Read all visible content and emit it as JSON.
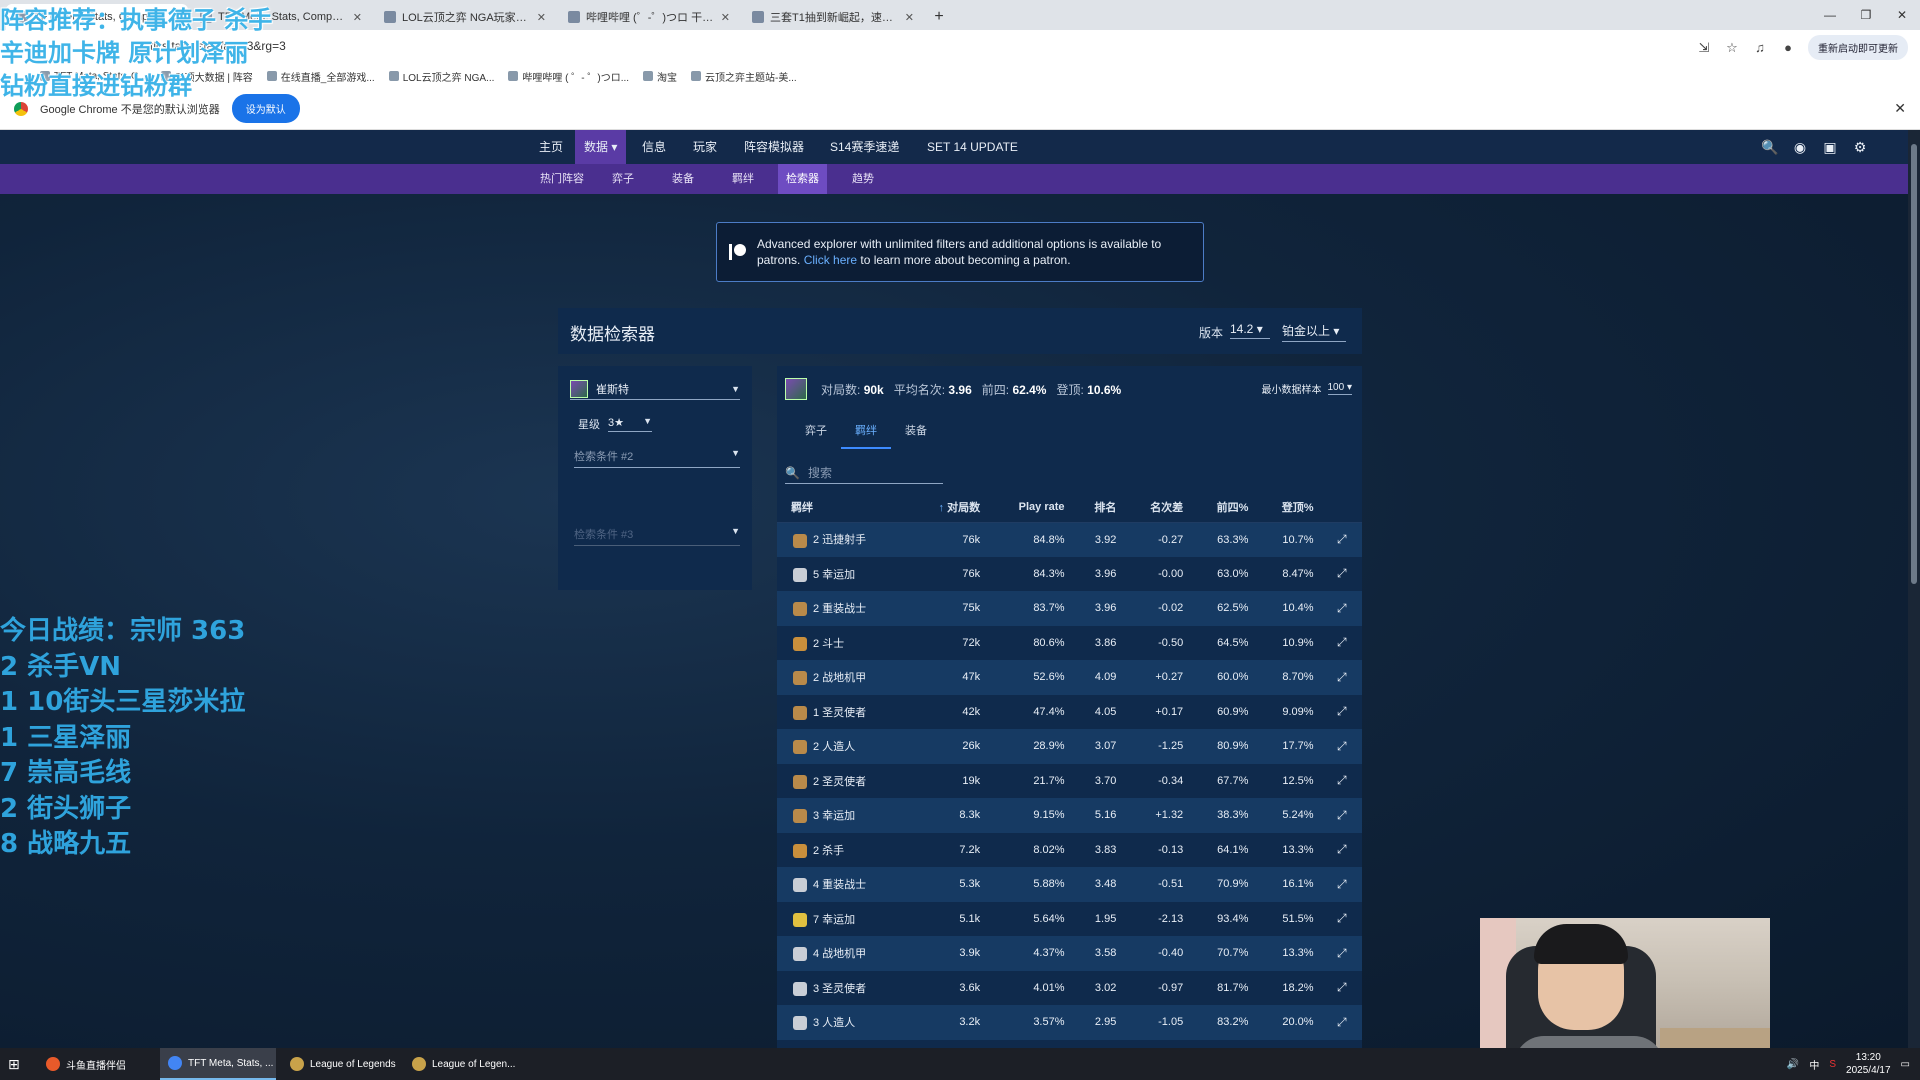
{
  "browser": {
    "tabs": [
      {
        "label": "TFT Meta, Stats, Comps, Mat",
        "active": true
      },
      {
        "label": "TFT Meta, Stats, Comps, Mat",
        "active": false
      },
      {
        "label": "LOL云顶之弈 NGA玩家社区 P1",
        "active": false
      },
      {
        "label": "哔哩哔哩 (゜-゜)つロ 干杯~-bi",
        "active": false
      },
      {
        "label": "三套T1抽到新崛起，速看最新",
        "active": false
      }
    ],
    "url": "tics.tac...stedfate_3&rg=3",
    "update_button": "重新启动即可更新",
    "bookmarks": [
      "TFT Meta, Stats, C...",
      "云顶大数据 | 阵容",
      "在线直播_全部游戏...",
      "LOL云顶之弈 NGA...",
      "哔哩哔哩 ( ゜- ゜)つロ...",
      "淘宝",
      "云顶之弈主题站-美..."
    ],
    "infobar_message": "Google Chrome 不是您的默认浏览器",
    "infobar_button": "设为默认"
  },
  "nav": {
    "items": [
      "主页",
      "数据",
      "信息",
      "玩家",
      "阵容模拟器",
      "S14赛季速递",
      "SET 14 UPDATE"
    ],
    "active": "数据",
    "sub_items": [
      "热门阵容",
      "弈子",
      "装备",
      "羁绊",
      "检索器",
      "趋势"
    ],
    "sub_active": "检索器"
  },
  "banner": {
    "text": "Advanced explorer with unlimited filters and additional options is available to patrons.",
    "link": "Click here",
    "suffix": "to learn more about becoming a patron."
  },
  "explorer": {
    "title": "数据检索器",
    "version_label": "版本",
    "version": "14.2",
    "rank": "铂金以上"
  },
  "filters": {
    "unit": "崔斯特",
    "star_label": "星级",
    "star": "3★",
    "cond2": "检索条件 #2",
    "cond3": "检索条件 #3"
  },
  "results": {
    "games_label": "对局数:",
    "games": "90k",
    "avg_label": "平均名次:",
    "avg": "3.96",
    "top4_label": "前四:",
    "top4": "62.4%",
    "win_label": "登顶:",
    "win": "10.6%",
    "min_sample_label": "最小数据样本",
    "min_sample": "100",
    "tabs": [
      "弈子",
      "羁绊",
      "装备"
    ],
    "active_tab": "羁绊",
    "search_placeholder": "搜索",
    "columns": [
      "羁绊",
      "对局数",
      "Play rate",
      "排名",
      "名次差",
      "前四%",
      "登顶%"
    ],
    "rows": [
      {
        "trait": "2 迅捷射手",
        "games": "76k",
        "play": "84.8%",
        "rank": "3.92",
        "delta": "-0.27",
        "top4": "63.3%",
        "win": "10.7%",
        "color": "#b98a4a"
      },
      {
        "trait": "5 幸运加",
        "games": "76k",
        "play": "84.3%",
        "rank": "3.96",
        "delta": "-0.00",
        "top4": "63.0%",
        "win": "8.47%",
        "color": "#c9ced6"
      },
      {
        "trait": "2 重装战士",
        "games": "75k",
        "play": "83.7%",
        "rank": "3.96",
        "delta": "-0.02",
        "top4": "62.5%",
        "win": "10.4%",
        "color": "#b98a4a"
      },
      {
        "trait": "2 斗士",
        "games": "72k",
        "play": "80.6%",
        "rank": "3.86",
        "delta": "-0.50",
        "top4": "64.5%",
        "win": "10.9%",
        "color": "#c98f3c"
      },
      {
        "trait": "2 战地机甲",
        "games": "47k",
        "play": "52.6%",
        "rank": "4.09",
        "delta": "+0.27",
        "top4": "60.0%",
        "win": "8.70%",
        "color": "#b98a4a"
      },
      {
        "trait": "1 圣灵使者",
        "games": "42k",
        "play": "47.4%",
        "rank": "4.05",
        "delta": "+0.17",
        "top4": "60.9%",
        "win": "9.09%",
        "color": "#b98a4a"
      },
      {
        "trait": "2 人造人",
        "games": "26k",
        "play": "28.9%",
        "rank": "3.07",
        "delta": "-1.25",
        "top4": "80.9%",
        "win": "17.7%",
        "color": "#b98a4a"
      },
      {
        "trait": "2 圣灵使者",
        "games": "19k",
        "play": "21.7%",
        "rank": "3.70",
        "delta": "-0.34",
        "top4": "67.7%",
        "win": "12.5%",
        "color": "#b98a4a"
      },
      {
        "trait": "3 幸运加",
        "games": "8.3k",
        "play": "9.15%",
        "rank": "5.16",
        "delta": "+1.32",
        "top4": "38.3%",
        "win": "5.24%",
        "color": "#b98a4a"
      },
      {
        "trait": "2 杀手",
        "games": "7.2k",
        "play": "8.02%",
        "rank": "3.83",
        "delta": "-0.13",
        "top4": "64.1%",
        "win": "13.3%",
        "color": "#c98f3c"
      },
      {
        "trait": "4 重装战士",
        "games": "5.3k",
        "play": "5.88%",
        "rank": "3.48",
        "delta": "-0.51",
        "top4": "70.9%",
        "win": "16.1%",
        "color": "#c9ced6"
      },
      {
        "trait": "7 幸运加",
        "games": "5.1k",
        "play": "5.64%",
        "rank": "1.95",
        "delta": "-2.13",
        "top4": "93.4%",
        "win": "51.5%",
        "color": "#e0c040"
      },
      {
        "trait": "4 战地机甲",
        "games": "3.9k",
        "play": "4.37%",
        "rank": "3.58",
        "delta": "-0.40",
        "top4": "70.7%",
        "win": "13.3%",
        "color": "#c9ced6"
      },
      {
        "trait": "3 圣灵使者",
        "games": "3.6k",
        "play": "4.01%",
        "rank": "3.02",
        "delta": "-0.97",
        "top4": "81.7%",
        "win": "18.2%",
        "color": "#c9ced6"
      },
      {
        "trait": "3 人造人",
        "games": "3.2k",
        "play": "3.57%",
        "rank": "2.95",
        "delta": "-1.05",
        "top4": "83.2%",
        "win": "20.0%",
        "color": "#c9ced6"
      }
    ]
  },
  "overlay": {
    "top_lines": [
      "阵容推荐：执事德子 杀手",
      "辛迪加卡牌 原计划泽丽",
      "钻粉直接进钻粉群"
    ],
    "left_lines": [
      "今日战绩：宗师 363",
      "2 杀手VN",
      "1 10街头三星莎米拉",
      "1 三星泽丽",
      "7 崇高毛线",
      "2 街头狮子",
      "8 战略九五"
    ]
  },
  "taskbar": {
    "apps": [
      "斗鱼直播伴侣",
      "TFT Meta, Stats, ...",
      "League of Legends",
      "League of Legen..."
    ],
    "ime": "中",
    "time": "13:20",
    "date": "2025/4/17"
  }
}
